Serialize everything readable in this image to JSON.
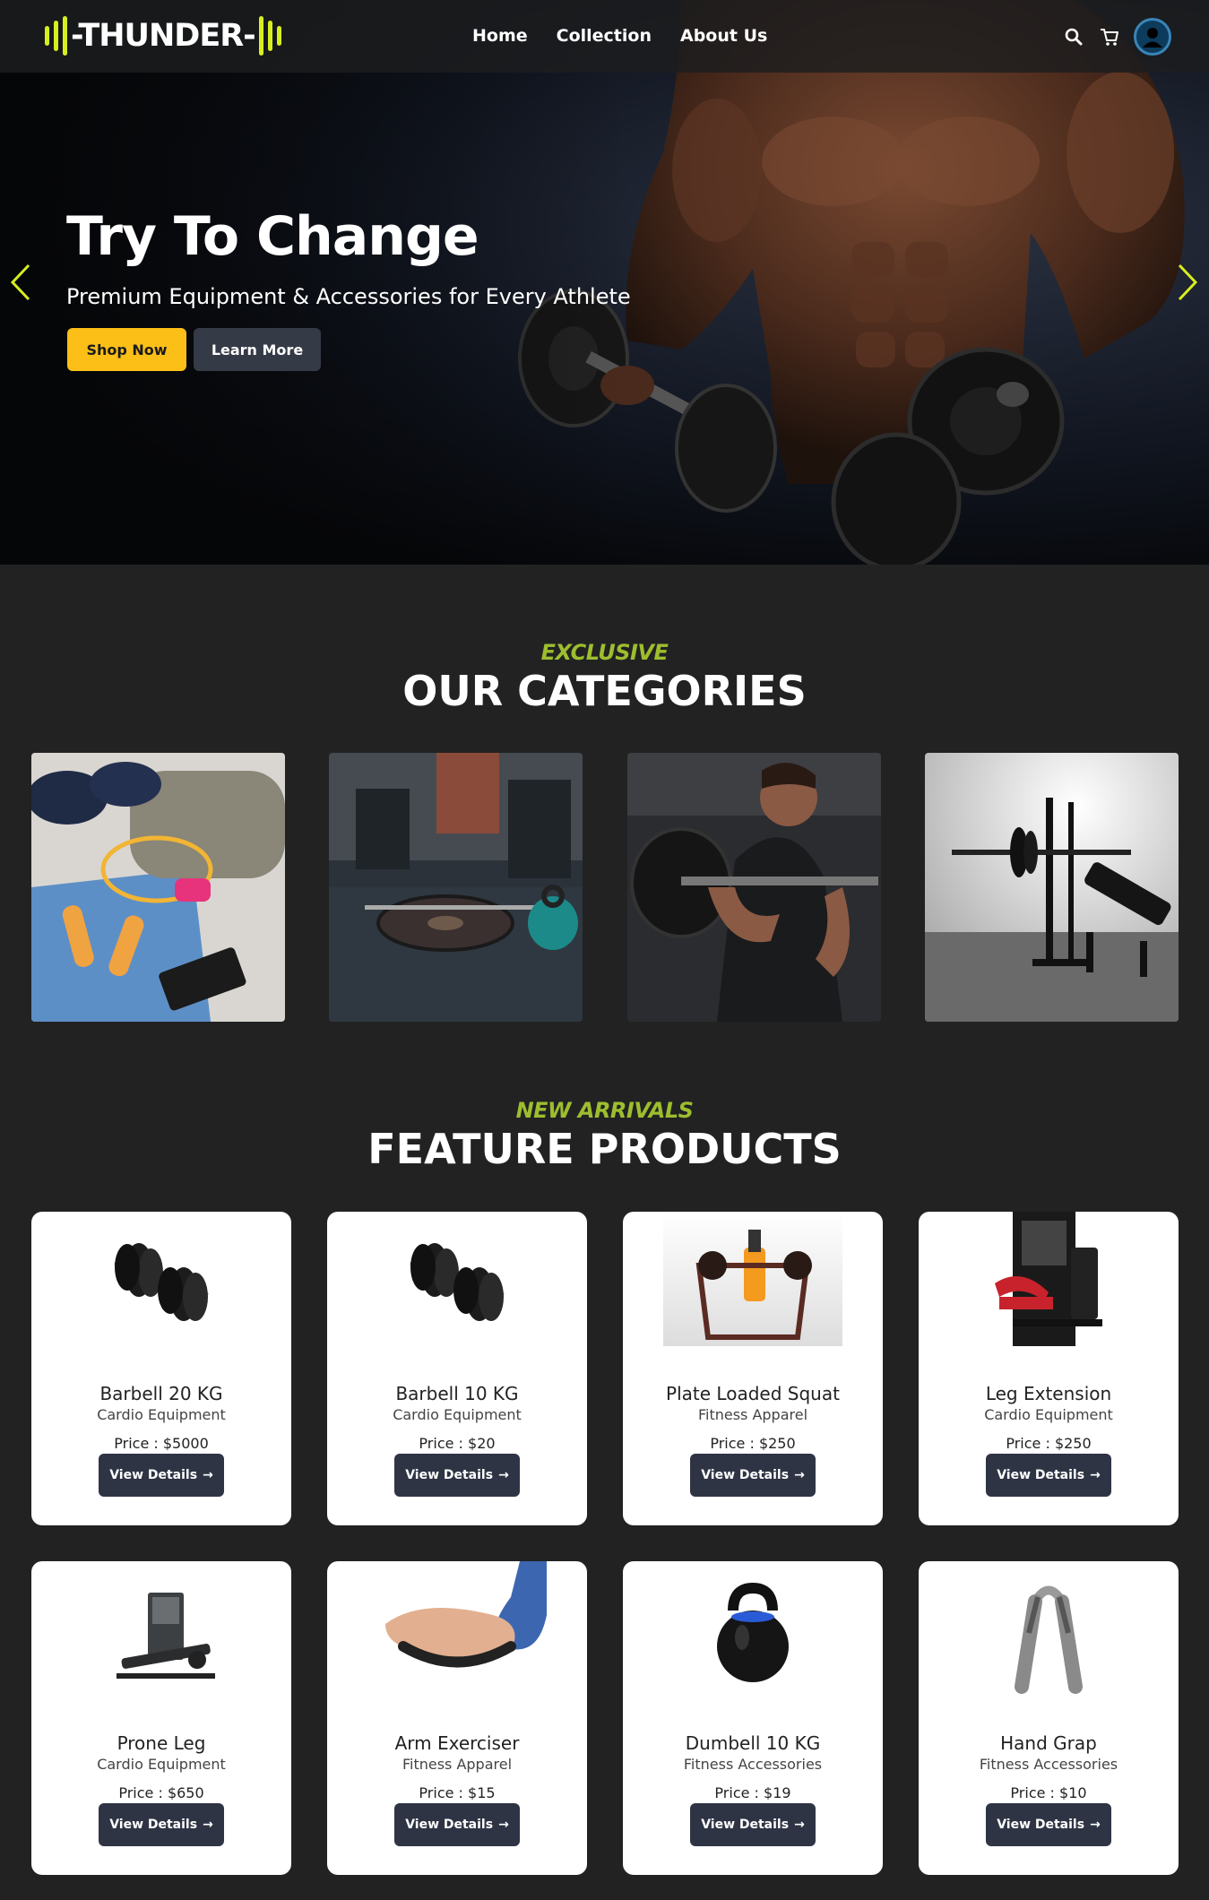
{
  "brand": {
    "logo_text": "-THUNDER-",
    "accent": "#d6ef21"
  },
  "nav": {
    "links": [
      "Home",
      "Collection",
      "About Us"
    ]
  },
  "nav_icons": [
    "search-icon",
    "cart-icon",
    "user-avatar-icon"
  ],
  "hero": {
    "title": "Try To Change",
    "subtitle": "Premium Equipment & Accessories for Every Athlete",
    "primary_button": "Shop Now",
    "secondary_button": "Learn More",
    "primary_color": "#fbbf18"
  },
  "categories": {
    "eyebrow": "EXCLUSIVE",
    "title": "OUR CATEGORIES"
  },
  "featured": {
    "eyebrow": "NEW ARRIVALS",
    "title": "FEATURE PRODUCTS",
    "button_label": "View Details",
    "products": [
      {
        "name": "Barbell 20 KG",
        "category": "Cardio Equipment",
        "price": "Price : $5000"
      },
      {
        "name": "Barbell 10 KG",
        "category": "Cardio Equipment",
        "price": "Price : $20"
      },
      {
        "name": "Plate Loaded Squat",
        "category": "Fitness Apparel",
        "price": "Price : $250"
      },
      {
        "name": "Leg Extension",
        "category": "Cardio Equipment",
        "price": "Price : $250"
      },
      {
        "name": "Prone Leg",
        "category": "Cardio Equipment",
        "price": "Price : $650"
      },
      {
        "name": "Arm Exerciser",
        "category": "Fitness Apparel",
        "price": "Price : $15"
      },
      {
        "name": "Dumbell 10 KG",
        "category": "Fitness Accessories",
        "price": "Price : $19"
      },
      {
        "name": "Hand Grap",
        "category": "Fitness Accessories",
        "price": "Price : $10"
      }
    ]
  }
}
